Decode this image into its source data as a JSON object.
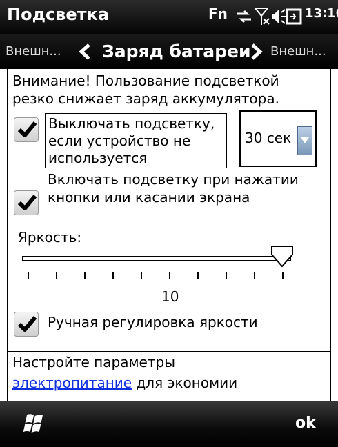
{
  "titlebar": {
    "title": "Подсветка",
    "status": {
      "fn_label": "Fn",
      "time": "13:10",
      "icons": [
        "sync-icon",
        "no-signal-icon",
        "volume-icon",
        "battery-charging-icon"
      ]
    }
  },
  "tabs": {
    "prev": "Внешн...",
    "current": "Заряд батареи",
    "next": "Внешн..."
  },
  "content": {
    "warning": "Внимание! Пользование подсветкой резко снижает заряд аккумулятора.",
    "option_turn_off": {
      "label": "Выключать подсветку, если устройство не используется",
      "checked": true
    },
    "timeout_select": {
      "value": "30 сек"
    },
    "option_turn_on": {
      "label": "Включать подсветку при нажатии кнопки или касании экрана",
      "checked": true
    },
    "brightness": {
      "label": "Яркость:",
      "value": "10",
      "ticks": 10,
      "level": 10
    },
    "option_manual": {
      "label": "Ручная регулировка яркости",
      "checked": true
    }
  },
  "footer": {
    "line1": "Настройте параметры",
    "link": "электропитание",
    "line2_rest": " для экономии"
  },
  "softkeys": {
    "right": "ok",
    "left_icon": "windows-start-icon"
  },
  "colors": {
    "link": "#1030e0",
    "bar": "#000000"
  }
}
